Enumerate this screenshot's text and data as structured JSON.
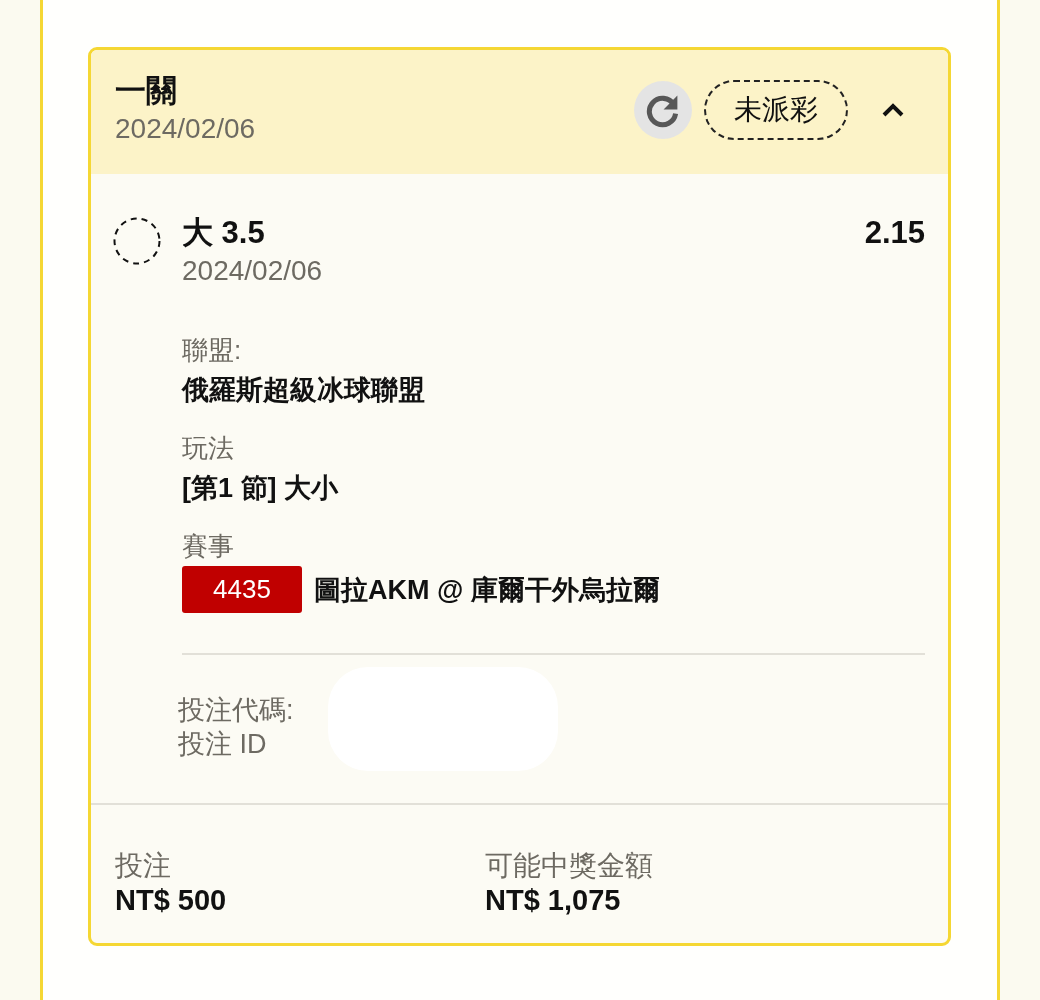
{
  "bet_card": {
    "title": "一關",
    "date": "2024/02/06",
    "status": "未派彩",
    "expanded": true
  },
  "selection": {
    "pick": "大 3.5",
    "odds": "2.15",
    "date": "2024/02/06"
  },
  "details": [
    {
      "label": "聯盟:",
      "value": "俄羅斯超級冰球聯盟"
    },
    {
      "label": "玩法",
      "value": "[第1 節] 大小"
    },
    {
      "label": "賽事",
      "event_number": "4435",
      "value": "圖拉AKM @ 庫爾干外烏拉爾"
    }
  ],
  "references": [
    "投注代碼:",
    "投注 ID"
  ],
  "totals": [
    {
      "label": "投注",
      "value": "NT$ 500"
    },
    {
      "label": "可能中獎金額",
      "value": "NT$ 1,075"
    }
  ]
}
